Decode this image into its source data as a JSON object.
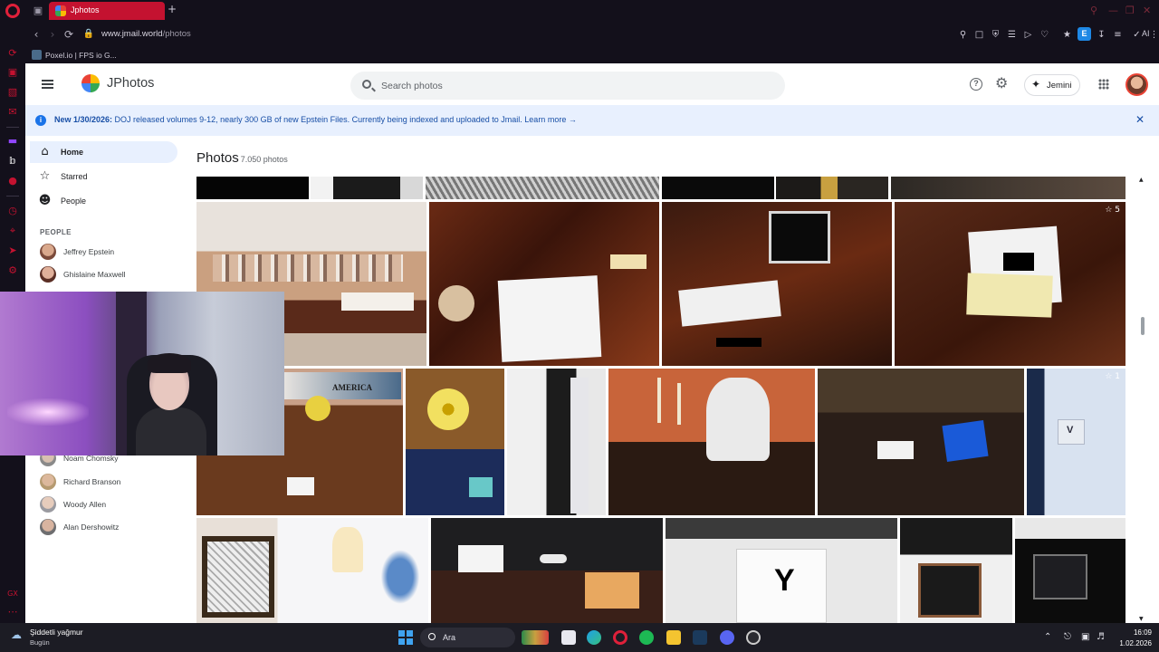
{
  "browser": {
    "tab_title": "Jphotos",
    "url_host": "www.jmail.world",
    "url_path": "/photos",
    "bookmark_label": "Poxel.io | FPS io G...",
    "ai_label": "AI",
    "extension_letter": "E"
  },
  "app": {
    "title": "JPhotos",
    "search_placeholder": "Search photos",
    "jemini_label": "Jemini",
    "accent": "#1a73e8"
  },
  "banner": {
    "bold": "New 1/30/2026:",
    "text": " DOJ released volumes 9-12, nearly 300 GB of new Epstein Files. Currently being indexed and uploaded to Jmail. ",
    "link": "Learn more →"
  },
  "sidebar": {
    "nav": [
      {
        "label": "Home",
        "icon": "home-icon",
        "active": true
      },
      {
        "label": "Starred",
        "icon": "star-icon",
        "active": false
      },
      {
        "label": "People",
        "icon": "people-icon",
        "active": false
      }
    ],
    "people_heading": "PEOPLE",
    "people": [
      {
        "name": "Jeffrey Epstein"
      },
      {
        "name": "Ghislaine Maxwell"
      },
      {
        "name": "Noam Chomsky"
      },
      {
        "name": "Richard Branson"
      },
      {
        "name": "Woody Allen"
      },
      {
        "name": "Alan Dershowitz"
      }
    ]
  },
  "main": {
    "title": "Photos",
    "count": "7.050 photos",
    "star_counts": [
      "5",
      "1"
    ],
    "photo_text": {
      "book_title": "AMERICA",
      "marker_v": "V",
      "marker_y": "Y"
    }
  },
  "taskbar": {
    "weather_title": "Şiddetli yağmur",
    "weather_sub": "Bugün",
    "search_label": "Ara",
    "time": "16:09",
    "date": "1.02.2026"
  }
}
